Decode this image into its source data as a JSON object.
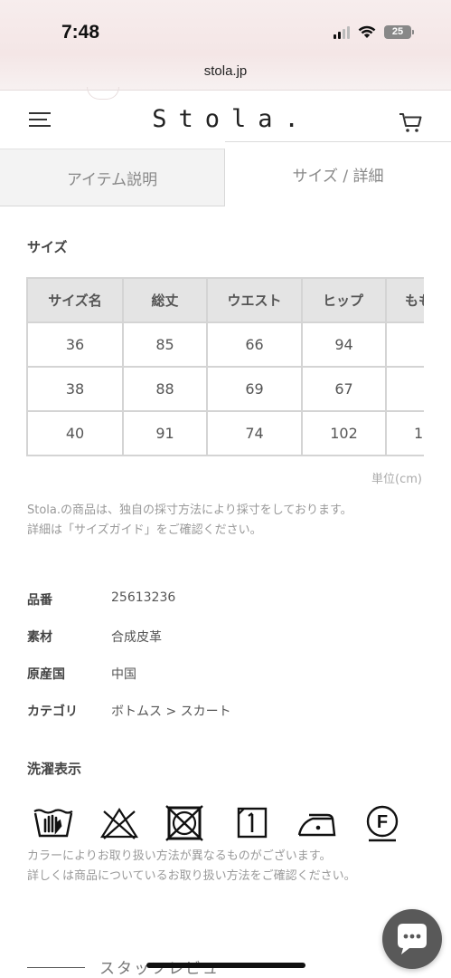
{
  "status_bar": {
    "time": "7:48",
    "battery": "25"
  },
  "browser": {
    "url": "stola.jp"
  },
  "header": {
    "logo": "Stola."
  },
  "tabs": [
    {
      "label": "アイテム説明",
      "active": false
    },
    {
      "label": "サイズ / 詳細",
      "active": true
    }
  ],
  "size_section": {
    "title": "サイズ",
    "headers": [
      "サイズ名",
      "総丈",
      "ウエスト",
      "ヒップ",
      "もも"
    ],
    "rows": [
      [
        "36",
        "85",
        "66",
        "94",
        ""
      ],
      [
        "38",
        "88",
        "69",
        "67",
        ""
      ],
      [
        "40",
        "91",
        "74",
        "102",
        "1"
      ]
    ],
    "unit": "単位(cm)",
    "note_line1": "Stola.の商品は、独自の採寸方法により採寸をしております。",
    "note_line2": "詳細は「サイズガイド」をご確認ください。"
  },
  "specs": [
    {
      "label": "品番",
      "value": "25613236"
    },
    {
      "label": "素材",
      "value": "合成皮革"
    },
    {
      "label": "原産国",
      "value": "中国"
    },
    {
      "label": "カテゴリ",
      "value": "ボトムス > スカート"
    }
  ],
  "laundry": {
    "title": "洗濯表示",
    "icons": [
      "hand-wash-icon",
      "no-bleach-icon",
      "no-tumble-dry-icon",
      "line-dry-icon",
      "iron-low-icon",
      "dry-clean-f-icon"
    ],
    "dry_clean_letter": "F",
    "note_line1": "カラーによりお取り扱い方法が異なるものがございます。",
    "note_line2": "詳しくは商品についているお取り扱い方法をご確認ください。"
  },
  "staff_review": {
    "label": "スタッフレビュ"
  },
  "colors": {
    "table_header_bg": "#e4e4e4",
    "tab_inactive_bg": "#f3f3f3",
    "chat_button": "#595959"
  }
}
